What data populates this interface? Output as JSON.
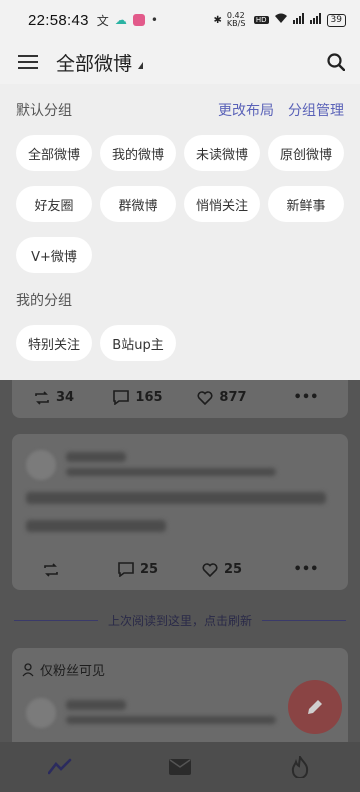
{
  "status": {
    "time": "22:58:43",
    "speed": "0.42 KB/S",
    "battery": "39"
  },
  "header": {
    "title": "全部微博"
  },
  "groups": {
    "default_title": "默认分组",
    "edit_layout": "更改布局",
    "manage_groups": "分组管理",
    "default_items": [
      "全部微博",
      "我的微博",
      "未读微博",
      "原创微博",
      "好友圈",
      "群微博",
      "悄悄关注",
      "新鲜事",
      "V+微博"
    ],
    "mine_title": "我的分组",
    "mine_items": [
      "特别关注",
      "B站up主"
    ]
  },
  "feed": {
    "post1_actions": {
      "reposts": "34",
      "comments": "165",
      "likes": "877"
    },
    "post2_actions": {
      "reposts": "",
      "comments": "25",
      "likes": "25"
    },
    "refresh_text": "上次阅读到这里，点击刷新",
    "fans_only_label": "仅粉丝可见"
  },
  "icons": [
    "menu-icon",
    "search-icon",
    "repost-icon",
    "comment-icon",
    "like-icon",
    "more-icon",
    "compose-icon",
    "home-icon",
    "mail-icon",
    "hot-icon"
  ]
}
